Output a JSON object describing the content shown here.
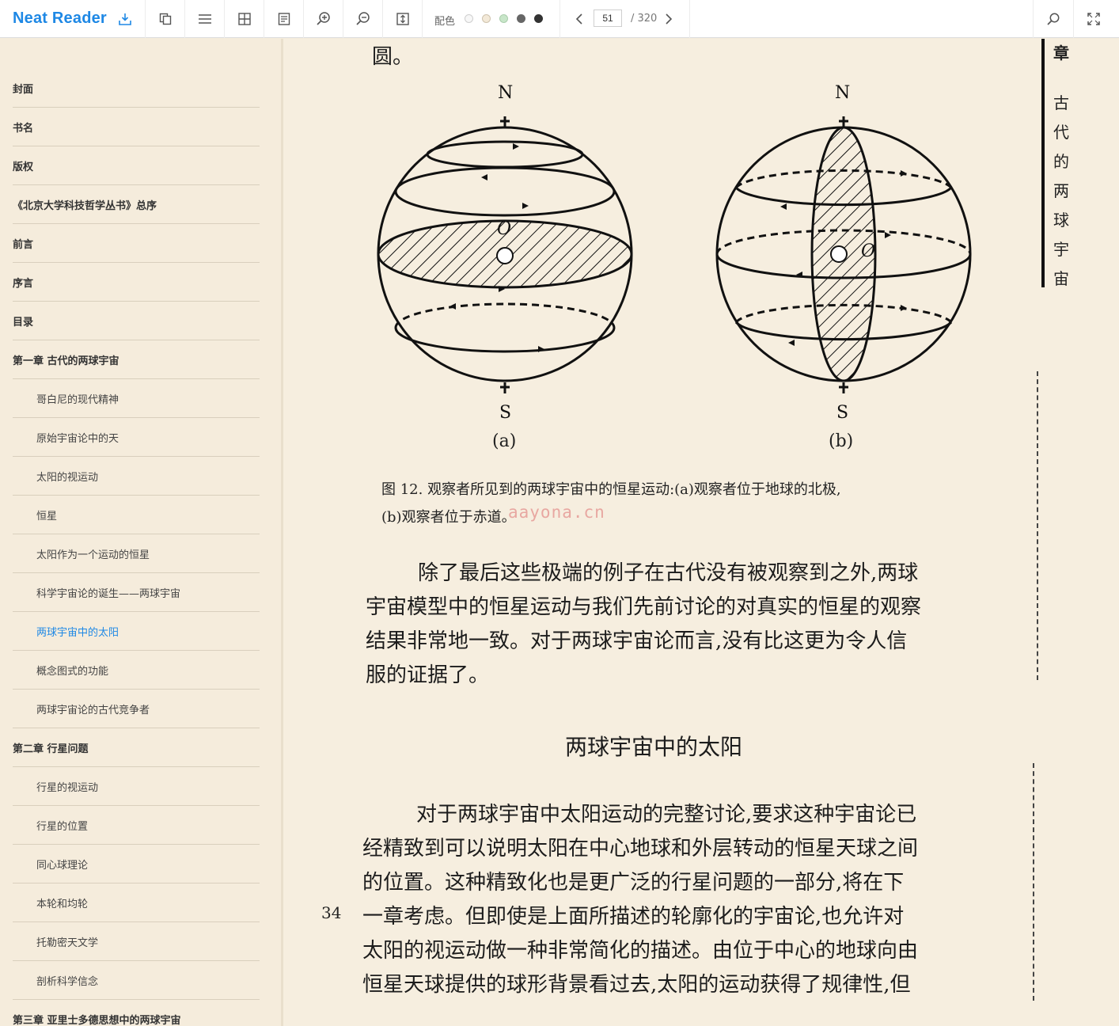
{
  "app": {
    "name": "Neat Reader"
  },
  "toolbar": {
    "theme_label": "配色",
    "theme_colors": [
      "#f7f7f7",
      "#f3e9d8",
      "#c8e6c9",
      "#666666",
      "#333333"
    ],
    "page_current": "51",
    "page_total": "/ 320",
    "icons": [
      "import-icon",
      "copy-icon",
      "list-icon",
      "grid-icon",
      "notes-icon",
      "zoom-in-icon",
      "zoom-out-icon",
      "fit-height-icon",
      "prev-page-icon",
      "next-page-icon",
      "search-icon",
      "fullscreen-icon"
    ]
  },
  "toc": [
    {
      "label": "封面",
      "level": 1
    },
    {
      "label": "书名",
      "level": 1
    },
    {
      "label": "版权",
      "level": 1
    },
    {
      "label": "《北京大学科技哲学丛书》总序",
      "level": 1
    },
    {
      "label": "前言",
      "level": 1
    },
    {
      "label": "序言",
      "level": 1
    },
    {
      "label": "目录",
      "level": 1
    },
    {
      "label": "第一章 古代的两球宇宙",
      "level": 1
    },
    {
      "label": "哥白尼的现代精神",
      "level": 2
    },
    {
      "label": "原始宇宙论中的天",
      "level": 2
    },
    {
      "label": "太阳的视运动",
      "level": 2
    },
    {
      "label": "恒星",
      "level": 2
    },
    {
      "label": "太阳作为一个运动的恒星",
      "level": 2
    },
    {
      "label": "科学宇宙论的诞生——两球宇宙",
      "level": 2
    },
    {
      "label": "两球宇宙中的太阳",
      "level": 2,
      "active": true
    },
    {
      "label": "概念图式的功能",
      "level": 2
    },
    {
      "label": "两球宇宙论的古代竞争者",
      "level": 2
    },
    {
      "label": "第二章 行星问题",
      "level": 1
    },
    {
      "label": "行星的视运动",
      "level": 2
    },
    {
      "label": "行星的位置",
      "level": 2
    },
    {
      "label": "同心球理论",
      "level": 2
    },
    {
      "label": "本轮和均轮",
      "level": 2
    },
    {
      "label": "托勒密天文学",
      "level": 2
    },
    {
      "label": "剖析科学信念",
      "level": 2
    },
    {
      "label": "第三章 亚里士多德思想中的两球宇宙",
      "level": 1
    }
  ],
  "page": {
    "top_fragment": "圆。",
    "figure": {
      "north": "N",
      "south": "S",
      "center": "O",
      "label_a": "(a)",
      "label_b": "(b)",
      "caption_line1": "图 12.  观察者所见到的两球宇宙中的恒星运动:(a)观察者位于地球的北极,",
      "caption_line2": "(b)观察者位于赤道。"
    },
    "watermark": "aayona.cn",
    "para1": [
      "除了最后这些极端的例子在古代没有被观察到之外,两球",
      "宇宙模型中的恒星运动与我们先前讨论的对真实的恒星的观察",
      "结果非常地一致。对于两球宇宙论而言,没有比这更为令人信",
      "服的证据了。"
    ],
    "heading": "两球宇宙中的太阳",
    "para2": [
      "对于两球宇宙中太阳运动的完整讨论,要求这种宇宙论已",
      "经精致到可以说明太阳在中心地球和外层转动的恒星天球之间",
      "的位置。这种精致化也是更广泛的行星问题的一部分,将在下",
      "一章考虑。但即使是上面所描述的轮廓化的宇宙论,也允许对",
      "太阳的视运动做一种非常简化的描述。由位于中心的地球向由",
      "恒星天球提供的球形背景看过去,太阳的运动获得了规律性,但"
    ],
    "page_number": "34",
    "side_title": [
      "章",
      "古",
      "代",
      "的",
      "两",
      "球",
      "宇",
      "宙"
    ]
  }
}
